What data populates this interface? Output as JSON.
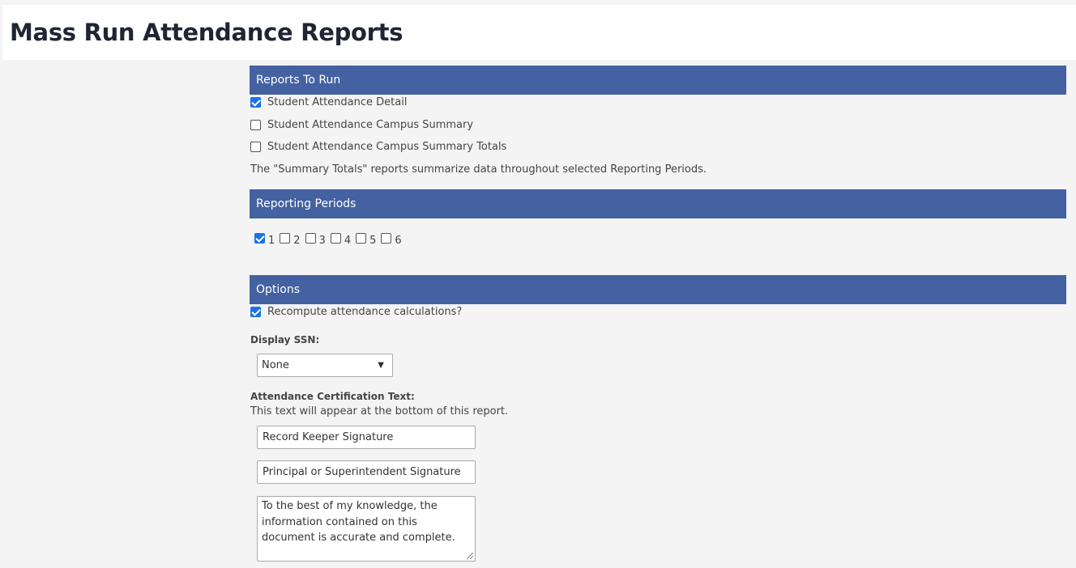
{
  "page": {
    "title": "Mass Run Attendance Reports"
  },
  "reports_to_run": {
    "header": "Reports To Run",
    "items": [
      {
        "label": "Student Attendance Detail",
        "checked": true
      },
      {
        "label": "Student Attendance Campus Summary",
        "checked": false
      },
      {
        "label": "Student Attendance Campus Summary Totals",
        "checked": false
      }
    ],
    "note": "The \"Summary Totals\" reports summarize data throughout selected Reporting Periods."
  },
  "reporting_periods": {
    "header": "Reporting Periods",
    "periods": [
      {
        "label": "1",
        "checked": true
      },
      {
        "label": "2",
        "checked": false
      },
      {
        "label": "3",
        "checked": false
      },
      {
        "label": "4",
        "checked": false
      },
      {
        "label": "5",
        "checked": false
      },
      {
        "label": "6",
        "checked": false
      }
    ]
  },
  "options": {
    "header": "Options",
    "recompute_label": "Recompute attendance calculations?",
    "recompute_checked": true,
    "display_ssn_label": "Display SSN:",
    "display_ssn_value": "None",
    "certification_label": "Attendance Certification Text:",
    "certification_note": "This text will appear at the bottom of this report.",
    "signature1": "Record Keeper Signature",
    "signature2": "Principal or Superintendent Signature",
    "statement": "To the best of my knowledge, the information contained on this document is accurate and complete."
  },
  "colors": {
    "header_bg": "#4461a1",
    "checkbox_checked": "#1a73e8"
  }
}
